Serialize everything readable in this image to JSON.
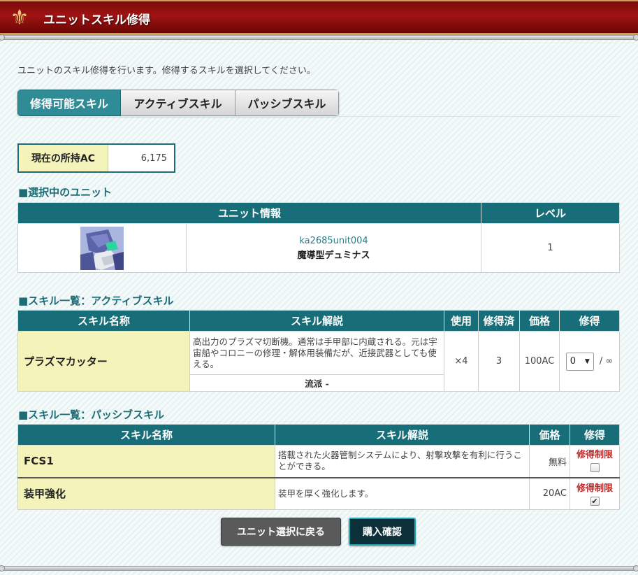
{
  "header": {
    "title": "ユニットスキル修得",
    "emblem_icon": "fleur-de-lis-icon"
  },
  "intro": "ユニットのスキル修得を行います。修得するスキルを選択してください。",
  "tabs": [
    {
      "label": "修得可能スキル",
      "active": true
    },
    {
      "label": "アクティブスキル",
      "active": false
    },
    {
      "label": "パッシブスキル",
      "active": false
    }
  ],
  "ac": {
    "label": "現在の所持AC",
    "value": "6,175"
  },
  "selected_unit": {
    "section_title": "■選択中のユニット",
    "headers": {
      "info": "ユニット情報",
      "level": "レベル"
    },
    "unit_id": "ka2685unit004",
    "unit_name": "魔導型デュミナス",
    "level": "1"
  },
  "active_skills": {
    "section_title": "■スキル一覧：アクティブスキル",
    "headers": {
      "name": "スキル名称",
      "desc": "スキル解説",
      "use": "使用",
      "learned": "修得済",
      "price": "価格",
      "acquire": "修得"
    },
    "rows": [
      {
        "name": "プラズマカッター",
        "desc": "高出力のプラズマ切断機。通常は手甲部に内蔵される。元は宇宙船やコロニーの修理・解体用装備だが、近接武器としても使える。",
        "school": "流派 -",
        "use": "×4",
        "learned": "3",
        "price": "100AC",
        "select_value": "0",
        "max": "/ ∞"
      }
    ]
  },
  "passive_skills": {
    "section_title": "■スキル一覧：パッシブスキル",
    "headers": {
      "name": "スキル名称",
      "desc": "スキル解説",
      "price": "価格",
      "acquire": "修得"
    },
    "rows": [
      {
        "name": "FCS1",
        "desc": "搭載された火器管制システムにより、射撃攻撃を有利に行うことができる。",
        "price": "無料",
        "limit": "修得制限",
        "checked": false
      },
      {
        "name": "装甲強化",
        "desc": "装甲を厚く強化します。",
        "price": "20AC",
        "limit": "修得制限",
        "checked": true
      }
    ]
  },
  "buttons": {
    "back": "ユニット選択に戻る",
    "confirm": "購入確認"
  },
  "colors": {
    "teal": "#186e78",
    "header_red": "#a21313",
    "name_bg": "#f4f4ba",
    "limit_red": "#c22a2a"
  }
}
